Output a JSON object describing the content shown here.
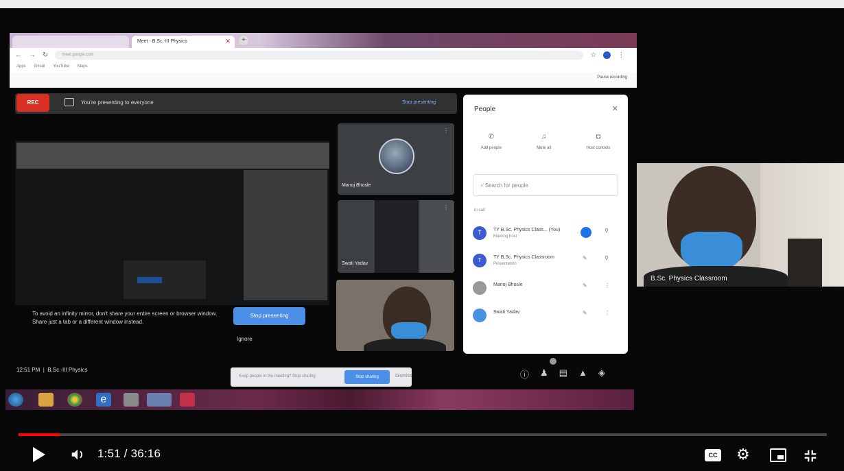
{
  "browser": {
    "tab1": "",
    "tab2": "Meet - B.Sc.-III Physics",
    "url": "meet.google.com",
    "bookmarks": [
      "Apps",
      "Gmail",
      "YouTube",
      "Maps"
    ],
    "pause_label": "Pause recording"
  },
  "meet": {
    "rec_label": "REC",
    "presenting_text": "You're presenting to everyone",
    "stop_presenting_top": "Stop presenting",
    "tip_text": "To avoid an infinity mirror, don't share your entire screen or browser window. Share just a tab or a different window instead.",
    "stop_presenting_btn": "Stop presenting",
    "ignore_label": "Ignore",
    "tiles": [
      {
        "name": "Manoj Bhosle"
      },
      {
        "name": "Swati Yadav"
      },
      {
        "name": ""
      }
    ],
    "time_label": "12:51 PM",
    "meeting_name": "B.Sc.-III Physics",
    "toast_text": "Keep people in the meeting? Stop sharing",
    "toast_btn": "Stop sharing",
    "toast_close": "Dismiss"
  },
  "people": {
    "title": "People",
    "actions": [
      {
        "label": "Add people",
        "icon": "add-person-icon"
      },
      {
        "label": "Mute all",
        "icon": "mute-icon"
      },
      {
        "label": "Host controls",
        "icon": "shield-icon"
      }
    ],
    "search_placeholder": "Search for people",
    "section_label": "In call",
    "rows": [
      {
        "initial": "T",
        "name": "TY B.Sc. Physics Class... (You)",
        "sub": "Meeting host"
      },
      {
        "initial": "T",
        "name": "TY B.Sc. Physics Classroom",
        "sub": "Presentation"
      },
      {
        "initial": "",
        "name": "Manoj Bhosle",
        "sub": ""
      },
      {
        "initial": "",
        "name": "Swati Yadav",
        "sub": ""
      }
    ]
  },
  "self_tile": {
    "label": "B.Sc. Physics Classroom"
  },
  "player": {
    "current": "1:51",
    "duration": "36:16",
    "time_display": "1:51 / 36:16",
    "progress_fraction": 0.051,
    "cc_label": "CC",
    "progress_color": "#ff0000"
  }
}
